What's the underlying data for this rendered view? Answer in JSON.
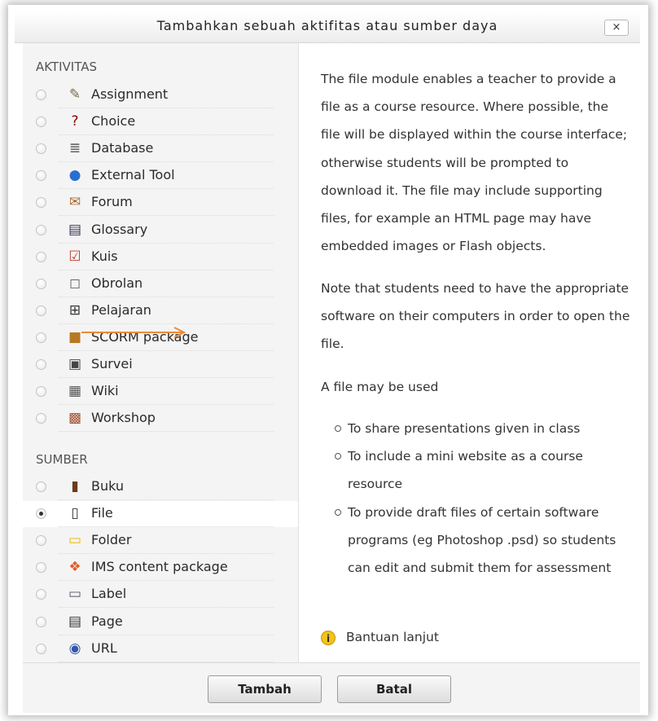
{
  "dialog": {
    "title": "Tambahkan sebuah aktifitas atau sumber daya",
    "close_label": "×"
  },
  "activities": {
    "heading": "AKTIVITAS",
    "items": [
      {
        "label": "Assignment",
        "icon": "assignment-icon",
        "glyph": "✎"
      },
      {
        "label": "Choice",
        "icon": "question-icon",
        "glyph": "?"
      },
      {
        "label": "Database",
        "icon": "database-icon",
        "glyph": "≣"
      },
      {
        "label": "External Tool",
        "icon": "globe-icon",
        "glyph": "●"
      },
      {
        "label": "Forum",
        "icon": "forum-icon",
        "glyph": "✉"
      },
      {
        "label": "Glossary",
        "icon": "glossary-icon",
        "glyph": "▤"
      },
      {
        "label": "Kuis",
        "icon": "quiz-check-icon",
        "glyph": "☑"
      },
      {
        "label": "Obrolan",
        "icon": "chat-bubble-icon",
        "glyph": "◻"
      },
      {
        "label": "Pelajaran",
        "icon": "lesson-flow-icon",
        "glyph": "⊞"
      },
      {
        "label": "SCORM package",
        "icon": "package-box-icon",
        "glyph": "■"
      },
      {
        "label": "Survei",
        "icon": "survey-icon",
        "glyph": "▣"
      },
      {
        "label": "Wiki",
        "icon": "wiki-icon",
        "glyph": "▦"
      },
      {
        "label": "Workshop",
        "icon": "workshop-icon",
        "glyph": "▩"
      }
    ]
  },
  "resources": {
    "heading": "SUMBER",
    "items": [
      {
        "label": "Buku",
        "icon": "book-icon",
        "glyph": "▮"
      },
      {
        "label": "File",
        "icon": "file-icon",
        "glyph": "▯",
        "selected": true
      },
      {
        "label": "Folder",
        "icon": "folder-icon",
        "glyph": "▭"
      },
      {
        "label": "IMS content package",
        "icon": "ims-package-icon",
        "glyph": "❖"
      },
      {
        "label": "Label",
        "icon": "label-icon",
        "glyph": "▭"
      },
      {
        "label": "Page",
        "icon": "page-icon",
        "glyph": "▤"
      },
      {
        "label": "URL",
        "icon": "url-globe-icon",
        "glyph": "◉"
      }
    ]
  },
  "description": {
    "paragraph1": "The file module enables a teacher to provide a file as a course resource. Where possible, the file will be displayed within the course interface; otherwise students will be prompted to download it. The file may include supporting files, for example an HTML page may have embedded images or Flash objects.",
    "paragraph2": "Note that students need to have the appropriate software on their computers in order to open the file.",
    "paragraph3": "A file may be used",
    "bullets": [
      "To share presentations given in class",
      "To include a mini website as a course resource",
      "To provide draft files of certain software programs (eg Photoshop .psd) so students can edit and submit them for assessment"
    ],
    "help_link": "Bantuan lanjut",
    "help_icon": "info-icon"
  },
  "footer": {
    "add_label": "Tambah",
    "cancel_label": "Batal"
  },
  "colors": {
    "annotation_arrow": "#ee8a3a",
    "help_icon": "#f3c21c"
  }
}
